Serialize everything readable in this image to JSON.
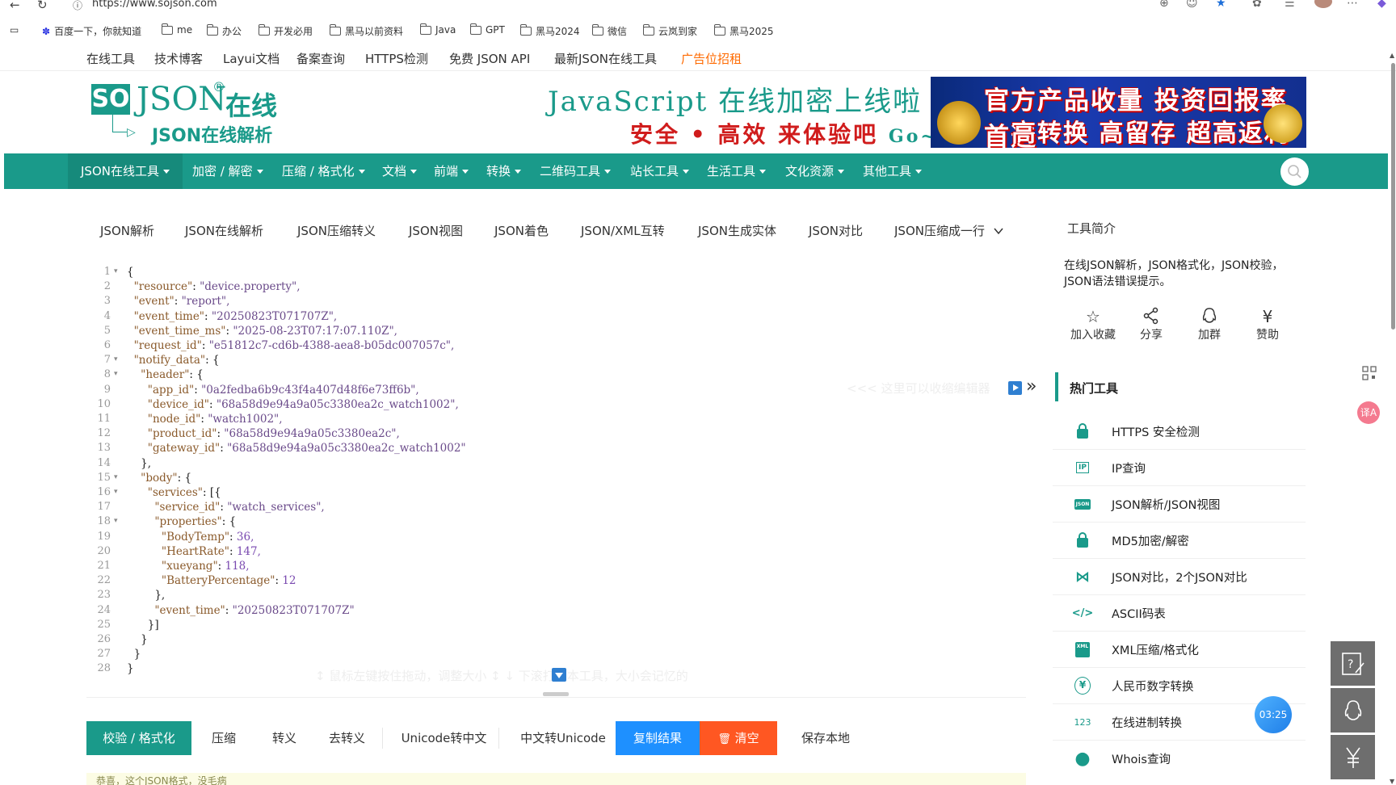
{
  "browser": {
    "url": "https://www.sojson.com",
    "back": "←",
    "reload": "↻"
  },
  "bookmarks": [
    "百度一下，你就知道",
    "me",
    "办公",
    "开发必用",
    "黑马以前资料",
    "Java",
    "GPT",
    "黑马2024",
    "微信",
    "云岚到家",
    "黑马2025"
  ],
  "top_links": [
    "在线工具",
    "技术博客",
    "Layui文档",
    "备案查询",
    "HTTPS检测",
    "免费 JSON API",
    "最新JSON在线工具",
    "广告位招租"
  ],
  "logo": {
    "so": "SO",
    "json": "JSON",
    "reg": "®",
    "zx": "在线",
    "sub": "JSON在线解析"
  },
  "slogan": {
    "line1": "JavaScript 在线加密上线啦",
    "line2": "安全 • 高效  来体验吧",
    "go": "Go~"
  },
  "banner": {
    "line1": "官方产品收量 投资回报率首选",
    "line2": "高转换 高留存 超高返利"
  },
  "main_nav": [
    "JSON在线工具",
    "加密 / 解密",
    "压缩 / 格式化",
    "文档",
    "前端",
    "转换",
    "二维码工具",
    "站长工具",
    "生活工具",
    "文化资源",
    "其他工具"
  ],
  "json_tabs": [
    "JSON解析",
    "JSON在线解析",
    "JSON压缩转义",
    "JSON视图",
    "JSON着色",
    "JSON/XML互转",
    "JSON生成实体",
    "JSON对比",
    "JSON压缩成一行"
  ],
  "editor": {
    "lines": [
      "{",
      "  \"resource\": \"device.property\",",
      "  \"event\": \"report\",",
      "  \"event_time\": \"20250823T071707Z\",",
      "  \"event_time_ms\": \"2025-08-23T07:17:07.110Z\",",
      "  \"request_id\": \"e51812c7-cd6b-4388-aea8-b05dc007057c\",",
      "  \"notify_data\": {",
      "    \"header\": {",
      "      \"app_id\": \"0a2fedba6b9c43f4a407d48f6e73ff6b\",",
      "      \"device_id\": \"68a58d9e94a9a05c3380ea2c_watch1002\",",
      "      \"node_id\": \"watch1002\",",
      "      \"product_id\": \"68a58d9e94a9a05c3380ea2c\",",
      "      \"gateway_id\": \"68a58d9e94a9a05c3380ea2c_watch1002\"",
      "    },",
      "    \"body\": {",
      "      \"services\": [{",
      "        \"service_id\": \"watch_services\",",
      "        \"properties\": {",
      "          \"BodyTemp\": 36,",
      "          \"HeartRate\": 147,",
      "          \"xueyang\": 118,",
      "          \"BatteryPercentage\": 12",
      "        },",
      "        \"event_time\": \"20250823T071707Z\"",
      "      }]",
      "    }",
      "  }",
      "}"
    ],
    "folds": [
      1,
      7,
      8,
      15,
      16,
      18
    ],
    "hint_right": "<<< 这里可以收缩编辑器",
    "hint_bottom": "↕ 鼠标左键按住拖动，调整大小  ↕  ↓  下滚打开本工具，大小会记忆的"
  },
  "buttons": [
    "校验 / 格式化",
    "压缩",
    "转义",
    "去转义",
    "Unicode转中文",
    "中文转Unicode",
    "复制结果",
    "清空",
    "保存本地"
  ],
  "clear_icon": "🗑",
  "result_text": "恭喜，这个JSON格式，没毛病",
  "intro": {
    "title": "工具简介",
    "text": "在线JSON解析，JSON格式化，JSON校验，JSON语法错误提示。"
  },
  "actions": [
    {
      "label": "加入收藏",
      "icon": "☆"
    },
    {
      "label": "分享",
      "icon": "share"
    },
    {
      "label": "加群",
      "icon": "qq"
    },
    {
      "label": "赞助",
      "icon": "¥"
    }
  ],
  "hot_title": "热门工具",
  "hot_tools": [
    {
      "label": "HTTPS 安全检测",
      "icon": "lock"
    },
    {
      "label": "IP查询",
      "icon": "IP"
    },
    {
      "label": "JSON解析/JSON视图",
      "icon": "JSON"
    },
    {
      "label": "MD5加密/解密",
      "icon": "lock"
    },
    {
      "label": "JSON对比，2个JSON对比",
      "icon": "⋈"
    },
    {
      "label": "ASCII码表",
      "icon": "</>"
    },
    {
      "label": "XML压缩/格式化",
      "icon": "XML"
    },
    {
      "label": "人民币数字转换",
      "icon": "¥"
    },
    {
      "label": "在线进制转换",
      "icon": "123"
    },
    {
      "label": "Whois查询",
      "icon": "●"
    }
  ],
  "timer": "03:25",
  "translate_icon": "译A"
}
